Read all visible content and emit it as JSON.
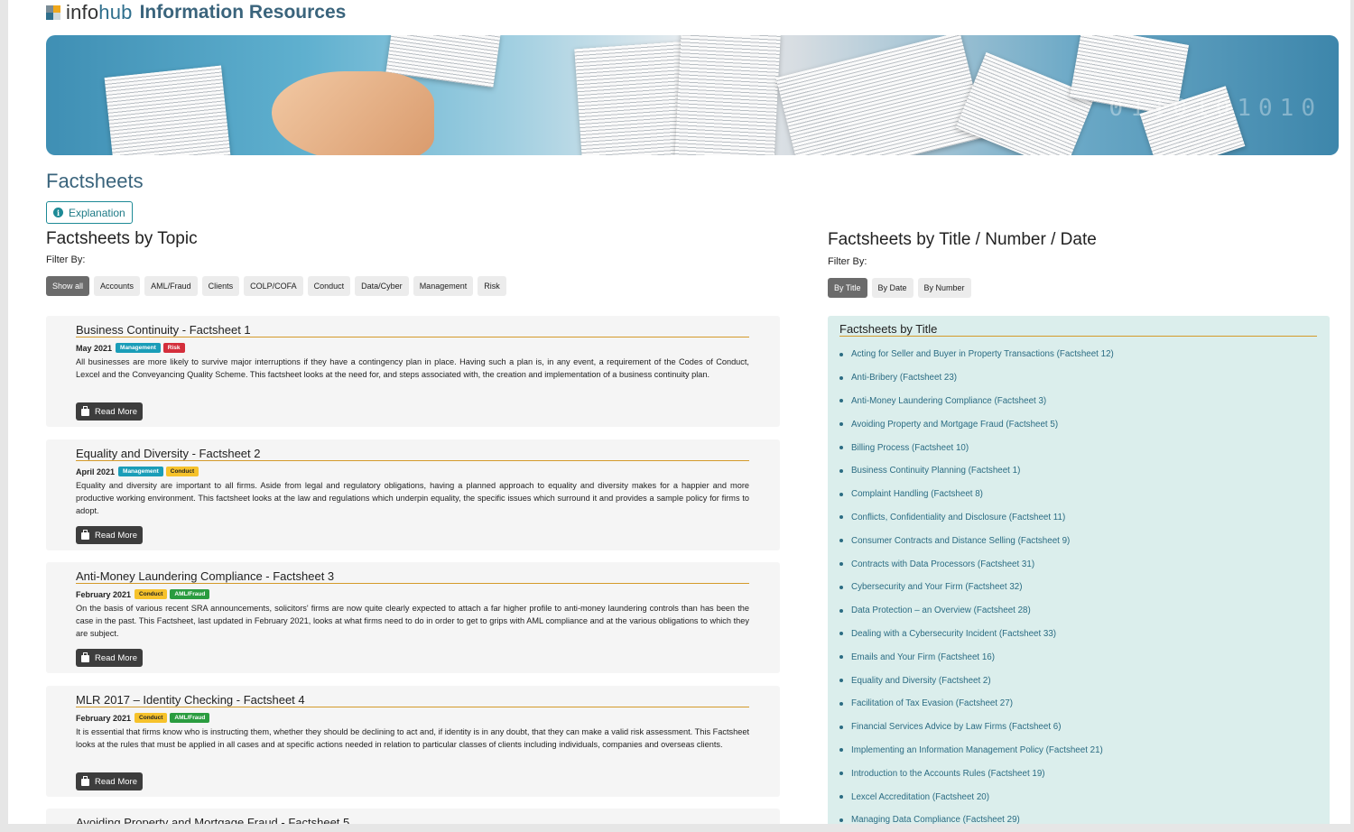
{
  "brand": {
    "word_prefix": "info",
    "word_suffix": "hub",
    "title": "Information Resources"
  },
  "page_title": "Factsheets",
  "explanation_button": "Explanation",
  "topic": {
    "heading": "Factsheets by Topic",
    "filter_label": "Filter By:",
    "filters": [
      {
        "label": "Show all",
        "active": true
      },
      {
        "label": "Accounts",
        "active": false
      },
      {
        "label": "AML/Fraud",
        "active": false
      },
      {
        "label": "Clients",
        "active": false
      },
      {
        "label": "COLP/COFA",
        "active": false
      },
      {
        "label": "Conduct",
        "active": false
      },
      {
        "label": "Data/Cyber",
        "active": false
      },
      {
        "label": "Management",
        "active": false
      },
      {
        "label": "Risk",
        "active": false
      }
    ]
  },
  "factsheets": [
    {
      "title": "Business Continuity - Factsheet 1",
      "date": "May 2021",
      "tags": [
        {
          "label": "Management",
          "kind": "management"
        },
        {
          "label": "Risk",
          "kind": "risk"
        }
      ],
      "body": "All businesses are more likely to survive major interruptions if they have a contingency plan in place. Having such a plan is, in any event, a requirement of the Codes of Conduct, Lexcel and the Conveyancing Quality Scheme. This factsheet looks at the need for, and steps associated with, the creation and implementation of a business continuity plan.",
      "read_more": "Read More"
    },
    {
      "title": "Equality and Diversity - Factsheet 2",
      "date": "April 2021",
      "tags": [
        {
          "label": "Management",
          "kind": "management"
        },
        {
          "label": "Conduct",
          "kind": "conduct"
        }
      ],
      "body": "Equality and diversity are important to all firms. Aside from legal and regulatory obligations, having a planned approach to equality and diversity makes for a happier and more productive working environment. This factsheet looks at the law and regulations which underpin equality, the specific issues which surround it and provides a sample policy for firms to adopt.",
      "read_more": "Read More"
    },
    {
      "title": "Anti-Money Laundering Compliance - Factsheet 3",
      "date": "February 2021",
      "tags": [
        {
          "label": "Conduct",
          "kind": "conduct"
        },
        {
          "label": "AML/Fraud",
          "kind": "aml"
        }
      ],
      "body": "On the basis of various recent SRA announcements, solicitors' firms are now quite clearly expected to attach a far higher profile to anti-money laundering controls than has been the case in the past. This Factsheet, last updated in February 2021, looks at what firms need to do in order to get to grips with AML compliance and at the various obligations to which they are subject.",
      "read_more": "Read More"
    },
    {
      "title": "MLR 2017 – Identity Checking - Factsheet 4",
      "date": "February 2021",
      "tags": [
        {
          "label": "Conduct",
          "kind": "conduct"
        },
        {
          "label": "AML/Fraud",
          "kind": "aml"
        }
      ],
      "body": "It is essential that firms know who is instructing them, whether they should be declining to act and, if identity is in any doubt, that they can make a valid risk assessment. This Factsheet looks at the rules that must be applied in all cases and at specific actions needed in relation to particular classes of clients including individuals, companies and overseas clients.",
      "read_more": "Read More"
    }
  ],
  "partial_card_title": "Avoiding Property and Mortgage Fraud - Factsheet 5",
  "title_section": {
    "heading": "Factsheets by Title / Number / Date",
    "filter_label": "Filter By:",
    "filters": [
      {
        "label": "By Title",
        "active": true
      },
      {
        "label": "By Date",
        "active": false
      },
      {
        "label": "By Number",
        "active": false
      }
    ],
    "list_title": "Factsheets by Title",
    "items": [
      "Acting for Seller and Buyer in Property Transactions (Factsheet 12)",
      "Anti-Bribery (Factsheet 23)",
      "Anti-Money Laundering Compliance (Factsheet 3)",
      "Avoiding Property and Mortgage Fraud (Factsheet 5)",
      "Billing Process (Factsheet 10)",
      "Business Continuity Planning (Factsheet 1)",
      "Complaint Handling (Factsheet 8)",
      "Conflicts, Confidentiality and Disclosure (Factsheet 11)",
      "Consumer Contracts and Distance Selling (Factsheet 9)",
      "Contracts with Data Processors (Factsheet 31)",
      "Cybersecurity and Your Firm (Factsheet 32)",
      "Data Protection – an Overview (Factsheet 28)",
      "Dealing with a Cybersecurity Incident (Factsheet 33)",
      "Emails and Your Firm (Factsheet 16)",
      "Equality and Diversity (Factsheet 2)",
      "Facilitation of Tax Evasion (Factsheet 27)",
      "Financial Services Advice by Law Firms (Factsheet 6)",
      "Implementing an Information Management Policy (Factsheet 21)",
      "Introduction to the Accounts Rules (Factsheet 19)",
      "Lexcel Accreditation (Factsheet 20)",
      "Managing Data Compliance (Factsheet 29)"
    ]
  },
  "colors": {
    "brand_blue": "#3a647c",
    "accent_rule": "#d49a2a",
    "tag_management": "#1a9db8",
    "tag_risk": "#d42e3b",
    "tag_conduct": "#f6c22b",
    "tag_aml": "#2a9c3f",
    "list_panel": "#dbeeec",
    "link": "#2b6c83"
  }
}
